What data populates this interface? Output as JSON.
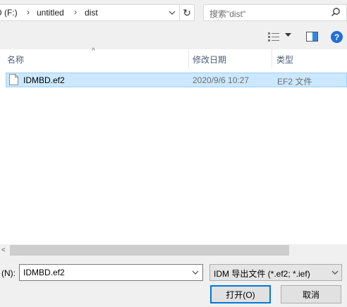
{
  "address": {
    "crumbs": [
      "D (F:)",
      "untitled",
      "dist"
    ]
  },
  "search": {
    "placeholder": "搜索\"dist\""
  },
  "columns": {
    "name": "名称",
    "modified": "修改日期",
    "type": "类型"
  },
  "files": [
    {
      "name": "IDMBD.ef2",
      "modified": "2020/9/6 10:27",
      "type": "EF2 文件"
    }
  ],
  "footer": {
    "filename_label": "(N):",
    "filename_value": "IDMBD.ef2",
    "filter_value": "IDM 导出文件 (*.ef2; *.ief)",
    "open_label": "打开(O)",
    "cancel_label": "取消"
  },
  "colors": {
    "selection": "#cce8ff",
    "selection_border": "#99d1ff",
    "header_text": "#4c607a",
    "help_blue": "#1f6fd6",
    "default_button_border": "#0078d7"
  },
  "icons": [
    "chevron-right-icon",
    "chevron-down-icon",
    "refresh-icon",
    "search-icon",
    "view-options-icon",
    "preview-pane-icon",
    "help-icon",
    "file-icon",
    "sort-up-icon",
    "scroll-left-icon"
  ]
}
